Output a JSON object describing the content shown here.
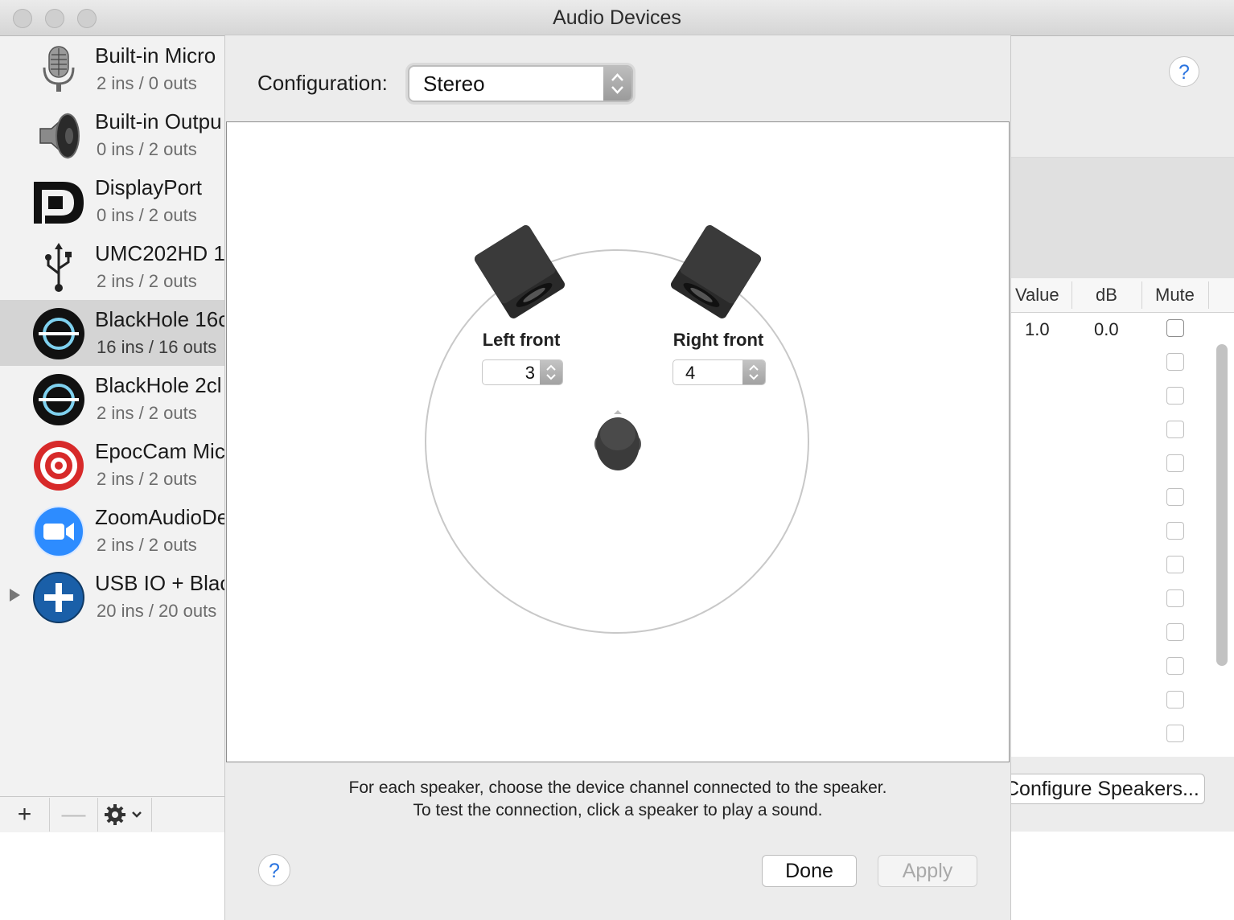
{
  "window": {
    "title": "Audio Devices"
  },
  "devices": [
    {
      "name": "Built-in Micro",
      "io": "2 ins / 0 outs",
      "icon": "microphone-icon"
    },
    {
      "name": "Built-in Outpu",
      "io": "0 ins / 2 outs",
      "icon": "speaker-icon"
    },
    {
      "name": "DisplayPort",
      "io": "0 ins / 2 outs",
      "icon": "displayport-icon"
    },
    {
      "name": "UMC202HD 1",
      "io": "2 ins / 2 outs",
      "icon": "usb-icon"
    },
    {
      "name": "BlackHole 16c",
      "io": "16 ins / 16 outs",
      "icon": "blackhole-icon",
      "selected": true
    },
    {
      "name": "BlackHole 2cl",
      "io": "2 ins / 2 outs",
      "icon": "blackhole-icon"
    },
    {
      "name": "EpocCam Mic",
      "io": "2 ins / 2 outs",
      "icon": "target-icon"
    },
    {
      "name": "ZoomAudioDe",
      "io": "2 ins / 2 outs",
      "icon": "zoom-camera-icon"
    },
    {
      "name": "USB IO + Blac",
      "io": "20 ins / 20 outs",
      "icon": "aggregate-plus-icon"
    }
  ],
  "sidebar_buttons": {
    "add": "+",
    "remove": "—"
  },
  "table": {
    "headers": {
      "value": "Value",
      "db": "dB",
      "mute": "Mute"
    },
    "first_row": {
      "value": "1.0",
      "db": "0.0"
    }
  },
  "right": {
    "help": "?",
    "configure_button": "Configure Speakers..."
  },
  "sheet": {
    "config_label": "Configuration:",
    "config_value": "Stereo",
    "speakers": {
      "left": {
        "label": "Left front",
        "channel": "3"
      },
      "right": {
        "label": "Right front",
        "channel": "4"
      }
    },
    "instruction_line1": "For each speaker, choose the device channel connected to the speaker.",
    "instruction_line2": "To test the connection, click a speaker to play a sound.",
    "help": "?",
    "done": "Done",
    "apply": "Apply"
  },
  "colors": {
    "accent": "#2a74e0",
    "selected_row": "#d4d4d4"
  }
}
